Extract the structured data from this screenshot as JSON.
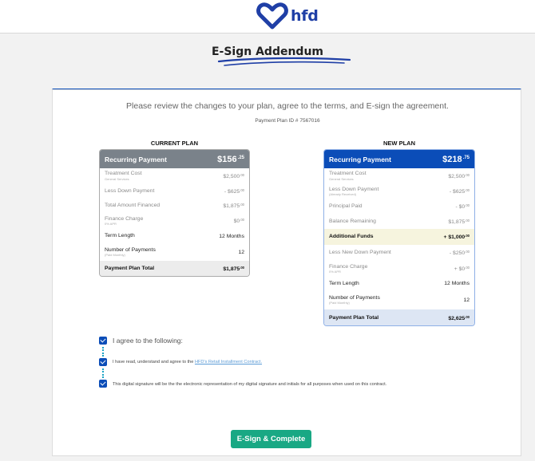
{
  "header": {
    "logo_text": "hfd",
    "logo_icon": "hfd-heart-logo-icon",
    "brand_color": "#1f3fa6"
  },
  "page": {
    "title": "E-Sign Addendum"
  },
  "intro": {
    "review_text": "Please review the changes to your plan, agree to the terms, and E-sign the agreement.",
    "plan_id": "Payment Plan ID # 7567016"
  },
  "current_plan": {
    "heading": "CURRENT PLAN",
    "header_label": "Recurring Payment",
    "header_amount": "$156",
    "header_cents": ".25",
    "rows": [
      {
        "label": "Treatment Cost",
        "sub": "General Services",
        "value": "$2,500",
        "cents": ".00"
      },
      {
        "label": "Less Down Payment",
        "sub": "",
        "value": "- $625",
        "cents": ".00"
      },
      {
        "label": "Total Amount Financed",
        "sub": "",
        "value": "$1,875",
        "cents": ".00"
      },
      {
        "label": "Finance Charge",
        "sub": "0% APR",
        "value": "$0",
        "cents": ".00"
      },
      {
        "label": "Term Length",
        "sub": "",
        "value": "12 Months",
        "cents": ""
      },
      {
        "label": "Number of Payments",
        "sub": "(Paid Monthly)",
        "value": "12",
        "cents": ""
      },
      {
        "label": "Payment Plan Total",
        "sub": "",
        "value": "$1,875",
        "cents": ".00"
      }
    ]
  },
  "new_plan": {
    "heading": "NEW PLAN",
    "header_label": "Recurring Payment",
    "header_amount": "$218",
    "header_cents": ".75",
    "rows": [
      {
        "label": "Treatment Cost",
        "sub": "General Services",
        "value": "$2,500",
        "cents": ".00"
      },
      {
        "label": "Less Down Payment",
        "sub": "(Already Received)",
        "value": "- $625",
        "cents": ".00"
      },
      {
        "label": "Principal Paid",
        "sub": "",
        "value": "- $0",
        "cents": ".00"
      },
      {
        "label": "Balance Remaining",
        "sub": "",
        "value": "$1,875",
        "cents": ".00"
      },
      {
        "label": "Additional Funds",
        "sub": "",
        "value": "+ $1,000",
        "cents": ".00"
      },
      {
        "label": "Less New Down Payment",
        "sub": "",
        "value": "- $250",
        "cents": ".00"
      },
      {
        "label": "Finance Charge",
        "sub": "0% APR",
        "value": "+ $0",
        "cents": ".00"
      },
      {
        "label": "Term Length",
        "sub": "",
        "value": "12 Months",
        "cents": ""
      },
      {
        "label": "Number of Payments",
        "sub": "(Paid Monthly)",
        "value": "12",
        "cents": ""
      },
      {
        "label": "Payment Plan Total",
        "sub": "",
        "value": "$2,625",
        "cents": ".00"
      }
    ]
  },
  "agreement": {
    "title": "I agree to the following:",
    "line1_prefix": "I have read, understand and agree to the ",
    "line1_link": "HFD's Retail Installment Contract.",
    "line2": "This digital signature will be the the electronic representation of my digital signature and initials for all purposes when used on this contract."
  },
  "actions": {
    "esign_label": "E-Sign & Complete"
  },
  "colors": {
    "primary_blue": "#0b4db8",
    "current_header_gray": "#7a828a",
    "button_green": "#19a884",
    "highlight_yellow": "#f6f4de"
  }
}
